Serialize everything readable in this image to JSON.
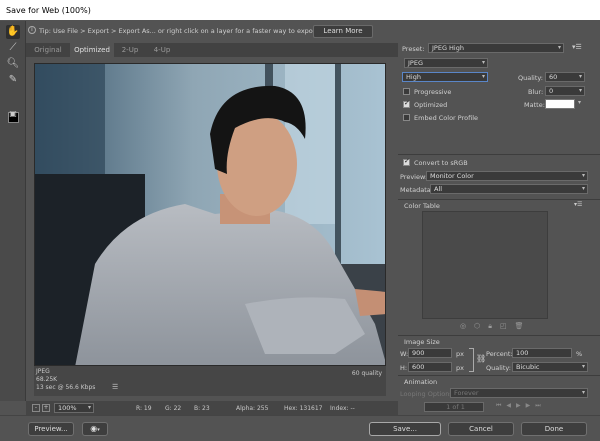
{
  "window": {
    "title": "Save for Web (100%)"
  },
  "tip": {
    "text": "Tip: Use File > Export > Export As...  or right click on a layer for a faster way to export assets",
    "learn_more": "Learn More"
  },
  "tabs": [
    {
      "label": "Original",
      "active": false
    },
    {
      "label": "Optimized",
      "active": true
    },
    {
      "label": "2-Up",
      "active": false
    },
    {
      "label": "4-Up",
      "active": false
    }
  ],
  "image_info": {
    "format": "JPEG",
    "size": "68.25K",
    "time": "13 sec @ 56.6 Kbps",
    "quality": "60 quality"
  },
  "status": {
    "zoom": "100%",
    "r": "R: 19",
    "g": "G: 22",
    "b": "B: 23",
    "alpha": "Alpha: 255",
    "hex": "Hex: 131617",
    "index": "Index: --"
  },
  "settings": {
    "preset_label": "Preset:",
    "preset_value": "JPEG High",
    "format": "JPEG",
    "compression": "High",
    "quality_label": "Quality:",
    "quality_value": "60",
    "progressive": "Progressive",
    "blur_label": "Blur:",
    "blur_value": "0",
    "optimized": "Optimized",
    "matte_label": "Matte:",
    "matte_color": "#ffffff",
    "embed_profile": "Embed Color Profile",
    "convert_srgb": "Convert to sRGB",
    "preview_label": "Preview:",
    "preview_value": "Monitor Color",
    "metadata_label": "Metadata:",
    "metadata_value": "All",
    "color_table": "Color Table"
  },
  "image_size": {
    "title": "Image Size",
    "w_label": "W:",
    "w_value": "900",
    "h_label": "H:",
    "h_value": "600",
    "unit": "px",
    "percent_label": "Percent:",
    "percent_value": "100",
    "percent_unit": "%",
    "quality_label": "Quality:",
    "quality_value": "Bicubic"
  },
  "animation": {
    "title": "Animation",
    "looping_label": "Looping Options:",
    "looping_value": "Forever",
    "frame": "1 of 1"
  },
  "buttons": {
    "preview": "Preview...",
    "save": "Save...",
    "cancel": "Cancel",
    "done": "Done"
  }
}
